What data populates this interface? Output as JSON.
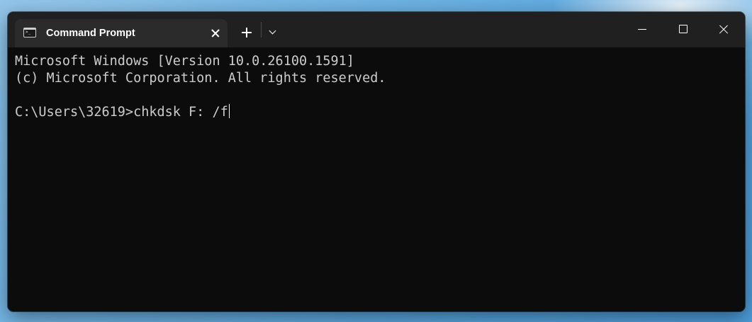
{
  "window": {
    "tab": {
      "title": "Command Prompt",
      "icon": "terminal-icon",
      "icon_text": ">_"
    },
    "titlebar_icons": {
      "tab_close": "close-icon",
      "new_tab": "plus-icon",
      "dropdown": "chevron-down-icon",
      "minimize": "minimize-icon",
      "maximize": "maximize-icon",
      "close": "close-icon"
    },
    "colors": {
      "terminal_background": "#0c0c0c",
      "terminal_text": "#cccccc",
      "titlebar": "#202020",
      "active_tab": "#2b2b2b"
    }
  },
  "terminal": {
    "lines": [
      "Microsoft Windows [Version 10.0.26100.1591]",
      "(c) Microsoft Corporation. All rights reserved."
    ],
    "prompt": "C:\\Users\\32619>",
    "command": "chkdsk F: /f"
  }
}
